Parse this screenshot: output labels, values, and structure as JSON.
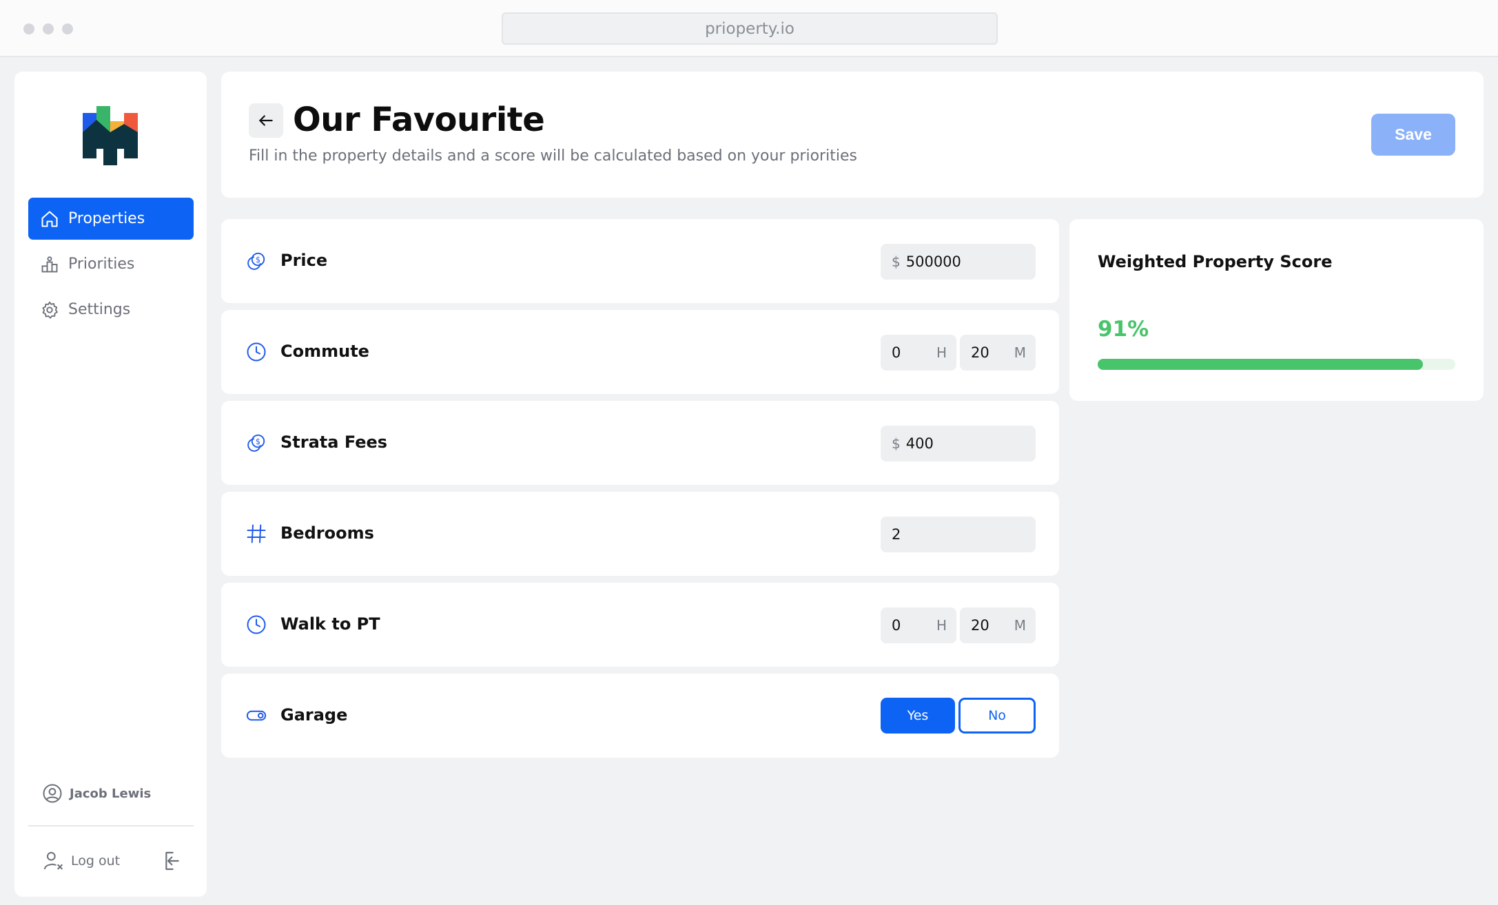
{
  "browser": {
    "url": "prioperty.io"
  },
  "sidebar": {
    "items": [
      {
        "label": "Properties",
        "icon": "home-icon",
        "active": true
      },
      {
        "label": "Priorities",
        "icon": "podium-icon",
        "active": false
      },
      {
        "label": "Settings",
        "icon": "gear-icon",
        "active": false
      }
    ],
    "user_name": "Jacob Lewis",
    "logout_label": "Log out"
  },
  "header": {
    "title": "Our Favourite",
    "subtitle": "Fill in the property details and a score will be calculated based on your priorities",
    "save_label": "Save"
  },
  "fields": {
    "price": {
      "label": "Price",
      "prefix": "$",
      "value": "500000",
      "icon": "dollar-coin-icon"
    },
    "commute": {
      "label": "Commute",
      "hours": "0",
      "hours_unit": "H",
      "minutes": "20",
      "minutes_unit": "M",
      "icon": "clock-icon"
    },
    "strata": {
      "label": "Strata Fees",
      "prefix": "$",
      "value": "400",
      "icon": "dollar-coin-icon"
    },
    "bedrooms": {
      "label": "Bedrooms",
      "value": "2",
      "icon": "hash-icon"
    },
    "walk": {
      "label": "Walk to PT",
      "hours": "0",
      "hours_unit": "H",
      "minutes": "20",
      "minutes_unit": "M",
      "icon": "clock-icon"
    },
    "garage": {
      "label": "Garage",
      "yes_label": "Yes",
      "no_label": "No",
      "selected": "Yes",
      "icon": "toggle-icon"
    }
  },
  "score": {
    "title": "Weighted Property Score",
    "value_label": "91%",
    "progress": 0.91
  },
  "colors": {
    "accent": "#0d63f3",
    "save_disabled": "#8bb1f8",
    "score_green": "#48c46a",
    "background": "#f1f2f4"
  }
}
